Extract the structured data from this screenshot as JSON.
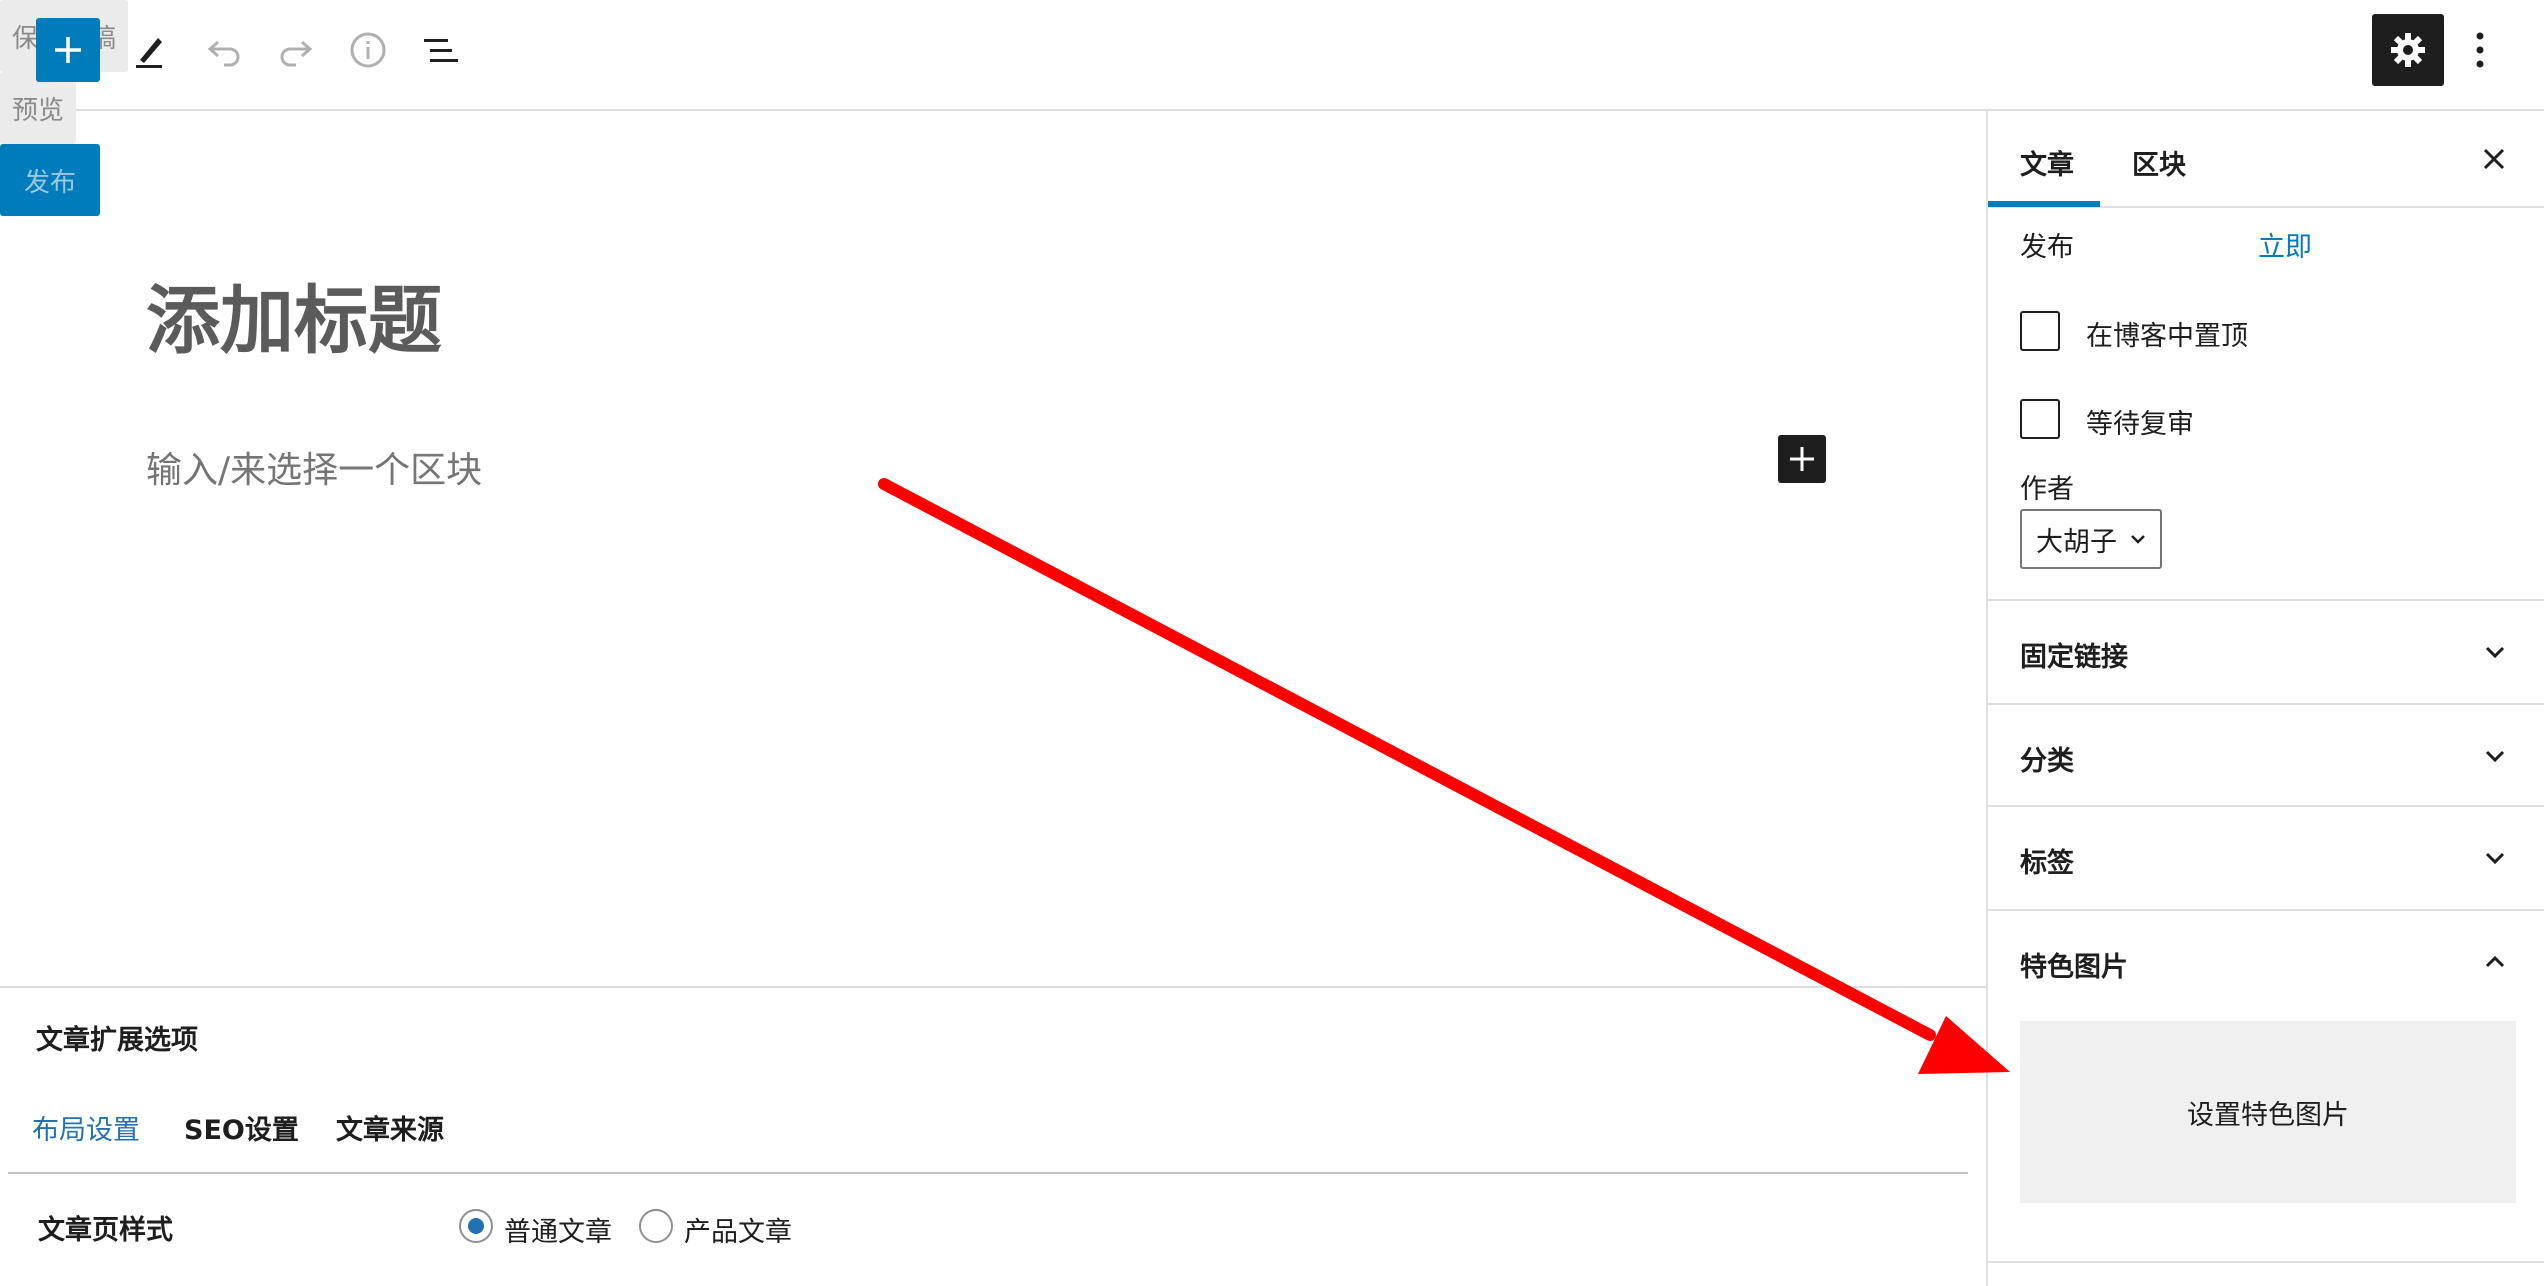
{
  "toolbar": {
    "save_draft_label": "保存草稿",
    "preview_label": "预览",
    "publish_label": "发布"
  },
  "editor": {
    "title_placeholder": "添加标题",
    "block_placeholder": "输入/来选择一个区块"
  },
  "metabox": {
    "title": "文章扩展选项",
    "tabs": [
      {
        "label": "布局设置",
        "active": true
      },
      {
        "label": "SEO设置",
        "active": false
      },
      {
        "label": "文章来源",
        "active": false
      }
    ],
    "field_label": "文章页样式",
    "options": [
      {
        "label": "普通文章",
        "checked": true
      },
      {
        "label": "产品文章",
        "checked": false
      }
    ]
  },
  "sidebar": {
    "tabs": [
      {
        "label": "文章",
        "active": true
      },
      {
        "label": "区块",
        "active": false
      }
    ],
    "publish_label": "发布",
    "publish_value": "立即",
    "sticky_label": "在博客中置顶",
    "pending_label": "等待复审",
    "author_label": "作者",
    "author_value": "大胡子",
    "panels": [
      {
        "title": "固定链接",
        "expanded": false
      },
      {
        "title": "分类",
        "expanded": false
      },
      {
        "title": "标签",
        "expanded": false
      },
      {
        "title": "特色图片",
        "expanded": true
      }
    ],
    "featured_button_label": "设置特色图片"
  },
  "colors": {
    "accent": "#007cba",
    "annotation_arrow": "#ff0000",
    "dark_button": "#1e1e1e"
  },
  "icons": [
    "plus-icon",
    "pen-icon",
    "undo-icon",
    "redo-icon",
    "info-icon",
    "list-view-icon",
    "gear-icon",
    "more-vertical-icon",
    "close-icon",
    "chevron-down-icon",
    "chevron-up-icon"
  ]
}
